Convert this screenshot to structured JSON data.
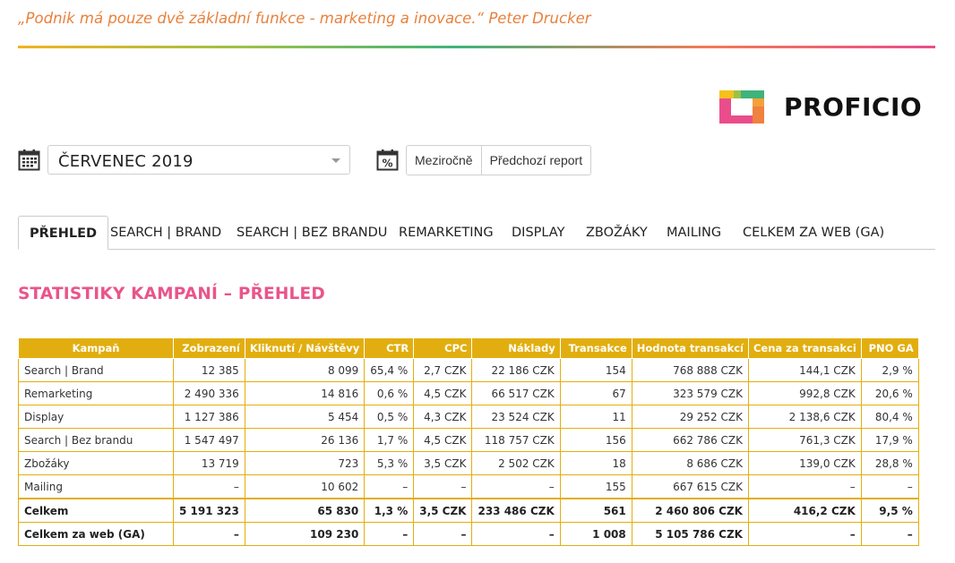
{
  "header": {
    "quote": "„Podnik má pouze dvě základní funkce - marketing a inovace.“ Peter Drucker",
    "brand_name": "PROFICIO",
    "gradient_colors": [
      "#f2b21f",
      "#9bc148",
      "#3fb37a",
      "#f07b55",
      "#ea4d8c"
    ]
  },
  "controls": {
    "month_value": "ČERVENEC 2019",
    "buttons": [
      "Meziročně",
      "Předchozí report"
    ]
  },
  "tabs": [
    {
      "label": "PŘEHLED",
      "active": true
    },
    {
      "label": "SEARCH | BRAND",
      "active": false
    },
    {
      "label": "SEARCH | BEZ BRANDU",
      "active": false
    },
    {
      "label": "REMARKETING",
      "active": false
    },
    {
      "label": "DISPLAY",
      "active": false
    },
    {
      "label": "ZBOŽÁKY",
      "active": false
    },
    {
      "label": "MAILING",
      "active": false
    },
    {
      "label": "CELKEM ZA WEB (GA)",
      "active": false
    }
  ],
  "section_title": "STATISTIKY KAMPANÍ – PŘEHLED",
  "table": {
    "header_color": "#e2ae0f",
    "columns": [
      "Kampaň",
      "Zobrazení",
      "Kliknutí / Návštěvy",
      "CTR",
      "CPC",
      "Náklady",
      "Transakce",
      "Hodnota transakcí",
      "Cena za transakci",
      "PNO GA"
    ],
    "rows": [
      [
        "Search | Brand",
        "12 385",
        "8 099",
        "65,4 %",
        "2,7 CZK",
        "22 186 CZK",
        "154",
        "768 888 CZK",
        "144,1 CZK",
        "2,9 %"
      ],
      [
        "Remarketing",
        "2 490 336",
        "14 816",
        "0,6 %",
        "4,5 CZK",
        "66 517 CZK",
        "67",
        "323 579 CZK",
        "992,8 CZK",
        "20,6 %"
      ],
      [
        "Display",
        "1 127 386",
        "5 454",
        "0,5 %",
        "4,3 CZK",
        "23 524 CZK",
        "11",
        "29 252 CZK",
        "2 138,6 CZK",
        "80,4 %"
      ],
      [
        "Search | Bez brandu",
        "1 547 497",
        "26 136",
        "1,7 %",
        "4,5 CZK",
        "118 757 CZK",
        "156",
        "662 786 CZK",
        "761,3 CZK",
        "17,9 %"
      ],
      [
        "Zbožáky",
        "13 719",
        "723",
        "5,3 %",
        "3,5 CZK",
        "2 502 CZK",
        "18",
        "8 686 CZK",
        "139,0 CZK",
        "28,8 %"
      ],
      [
        "Mailing",
        "–",
        "10 602",
        "–",
        "–",
        "–",
        "155",
        "667 615 CZK",
        "–",
        "–"
      ]
    ],
    "total": [
      "Celkem",
      "5 191 323",
      "65 830",
      "1,3 %",
      "3,5 CZK",
      "233 486 CZK",
      "561",
      "2 460 806 CZK",
      "416,2 CZK",
      "9,5 %"
    ],
    "web": [
      "Celkem za web (GA)",
      "–",
      "109 230",
      "–",
      "–",
      "–",
      "1 008",
      "5 105 786 CZK",
      "–",
      "–"
    ]
  }
}
